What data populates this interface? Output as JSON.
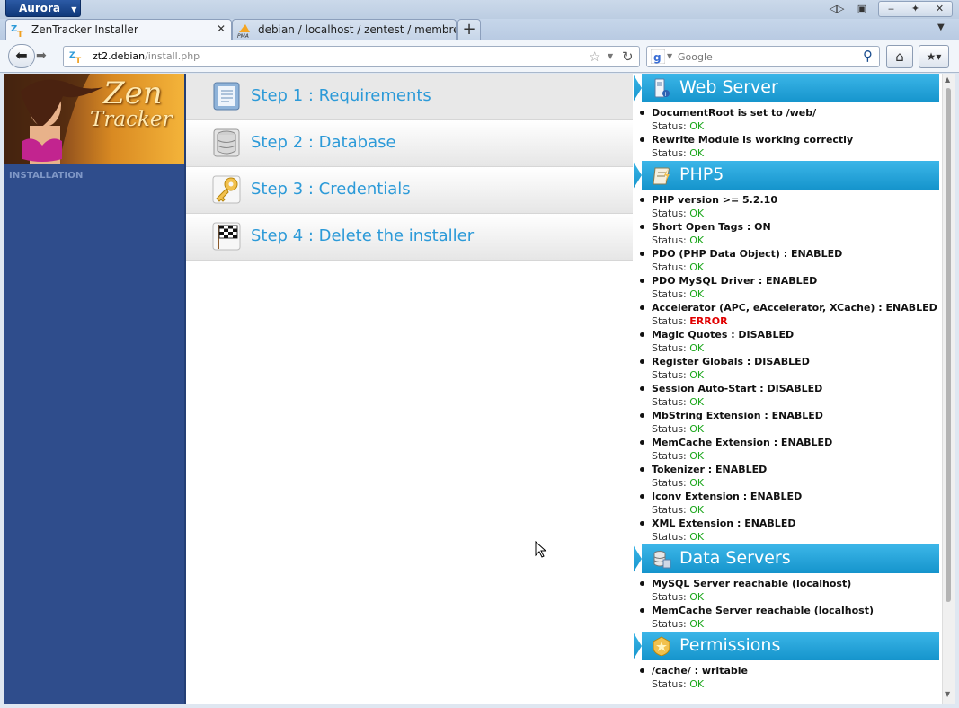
{
  "browser": {
    "app_button": "Aurora",
    "tabs": [
      {
        "title": "ZenTracker Installer",
        "active": true,
        "favicon": "zentracker-icon"
      },
      {
        "title": "debian / localhost / zentest / membre |...",
        "active": false,
        "favicon": "phpmyadmin-icon"
      }
    ],
    "new_tab_label": "+",
    "url_host": "zt2.debian",
    "url_path": "/install.php",
    "search_placeholder": "Google"
  },
  "sidebar": {
    "logo_line1": "Zen",
    "logo_line2": "Tracker",
    "section_label": "INSTALLATION"
  },
  "steps": [
    {
      "label": "Step 1 : Requirements",
      "icon": "notebook-icon",
      "current": true
    },
    {
      "label": "Step 2 : Database",
      "icon": "database-icon",
      "current": false
    },
    {
      "label": "Step 3 : Credentials",
      "icon": "key-icon",
      "current": false
    },
    {
      "label": "Step 4 : Delete the installer",
      "icon": "checkered-flag-icon",
      "current": false
    }
  ],
  "requirements": [
    {
      "title": "Web Server",
      "icon": "server-icon",
      "checks": [
        {
          "name": "DocumentRoot is set to /web/",
          "status": "OK"
        },
        {
          "name": "Rewrite Module is working correctly",
          "status": "OK"
        }
      ]
    },
    {
      "title": "PHP5",
      "icon": "php-script-icon",
      "checks": [
        {
          "name": "PHP version >= 5.2.10",
          "status": "OK"
        },
        {
          "name": "Short Open Tags : ON",
          "status": "OK"
        },
        {
          "name": "PDO (PHP Data Object) : ENABLED",
          "status": "OK"
        },
        {
          "name": "PDO MySQL Driver : ENABLED",
          "status": "OK"
        },
        {
          "name": "Accelerator (APC, eAccelerator, XCache) : ENABLED",
          "status": "ERROR"
        },
        {
          "name": "Magic Quotes : DISABLED",
          "status": "OK"
        },
        {
          "name": "Register Globals : DISABLED",
          "status": "OK"
        },
        {
          "name": "Session Auto-Start : DISABLED",
          "status": "OK"
        },
        {
          "name": "MbString Extension : ENABLED",
          "status": "OK"
        },
        {
          "name": "MemCache Extension : ENABLED",
          "status": "OK"
        },
        {
          "name": "Tokenizer : ENABLED",
          "status": "OK"
        },
        {
          "name": "Iconv Extension : ENABLED",
          "status": "OK"
        },
        {
          "name": "XML Extension : ENABLED",
          "status": "OK"
        }
      ]
    },
    {
      "title": "Data Servers",
      "icon": "database-servers-icon",
      "checks": [
        {
          "name": "MySQL Server reachable (localhost)",
          "status": "OK"
        },
        {
          "name": "MemCache Server reachable (localhost)",
          "status": "OK"
        }
      ]
    },
    {
      "title": "Permissions",
      "icon": "badge-icon",
      "checks": [
        {
          "name": "/cache/ : writable",
          "status": "OK"
        }
      ]
    }
  ],
  "status_prefix": "Status: ",
  "colors": {
    "ok": "#1aa61a",
    "error": "#e10000",
    "accent": "#2c9ad8",
    "sidebar": "#2f4d8c"
  }
}
